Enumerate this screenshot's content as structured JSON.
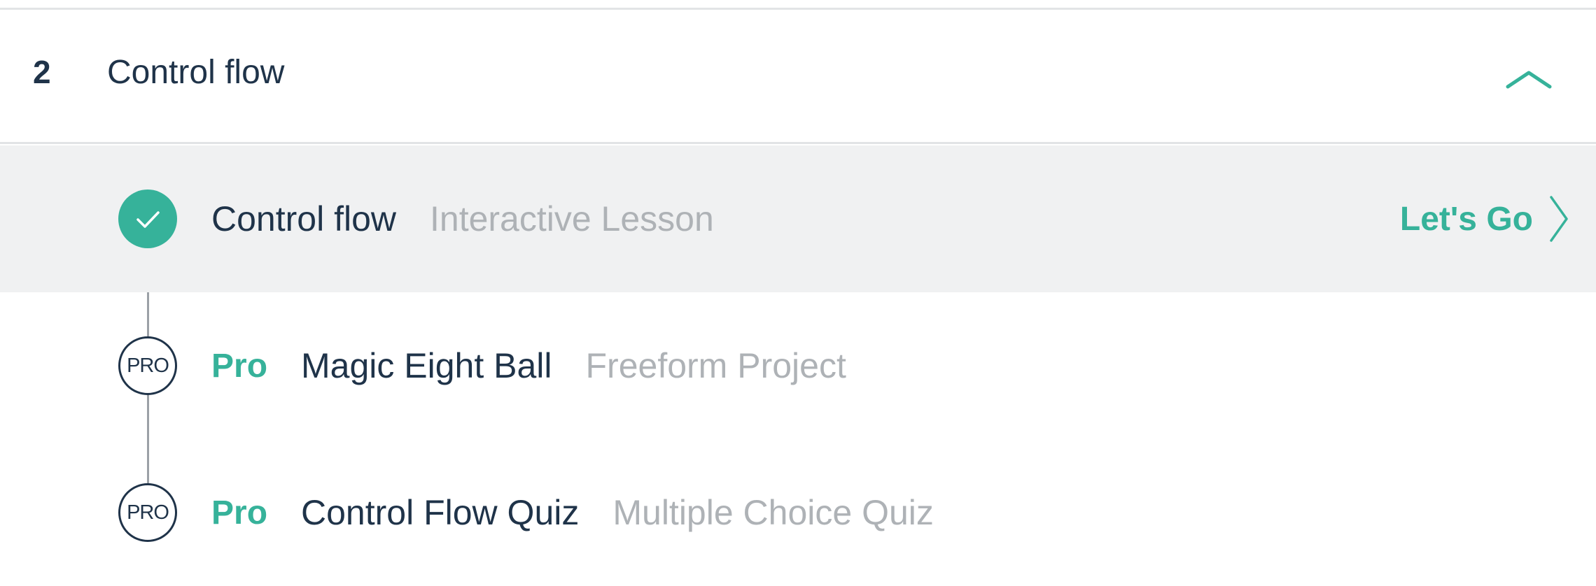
{
  "section": {
    "number": "2",
    "title": "Control flow"
  },
  "items": [
    {
      "status": "completed",
      "status_icon": "checkmark-icon",
      "title": "Control flow",
      "type": "Interactive Lesson",
      "action_label": "Let's Go"
    },
    {
      "status": "locked",
      "status_label": "PRO",
      "badge": "Pro",
      "title": "Magic Eight Ball",
      "type": "Freeform Project"
    },
    {
      "status": "locked",
      "status_label": "PRO",
      "badge": "Pro",
      "title": "Control Flow Quiz",
      "type": "Multiple Choice Quiz"
    }
  ],
  "colors": {
    "accent": "#36b29a",
    "text_dark": "#1f3349",
    "text_muted": "#aeb2b6",
    "active_row_bg": "#f0f1f2"
  }
}
